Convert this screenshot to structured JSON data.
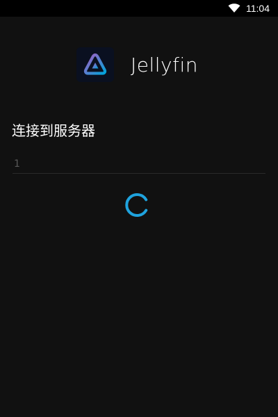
{
  "status_bar": {
    "time": "11:04",
    "wifi_icon": "wifi-icon"
  },
  "app": {
    "name": "Jellyfin",
    "logo_icon": "jellyfin-logo-icon"
  },
  "connect": {
    "title": "连接到服务器",
    "server_value": "1"
  },
  "loading": {
    "icon": "loading-spinner-icon"
  },
  "colors": {
    "background": "#111111",
    "spinner": "#1fa3de",
    "logo_purple": "#a95ce0",
    "logo_blue": "#00a4dc"
  }
}
